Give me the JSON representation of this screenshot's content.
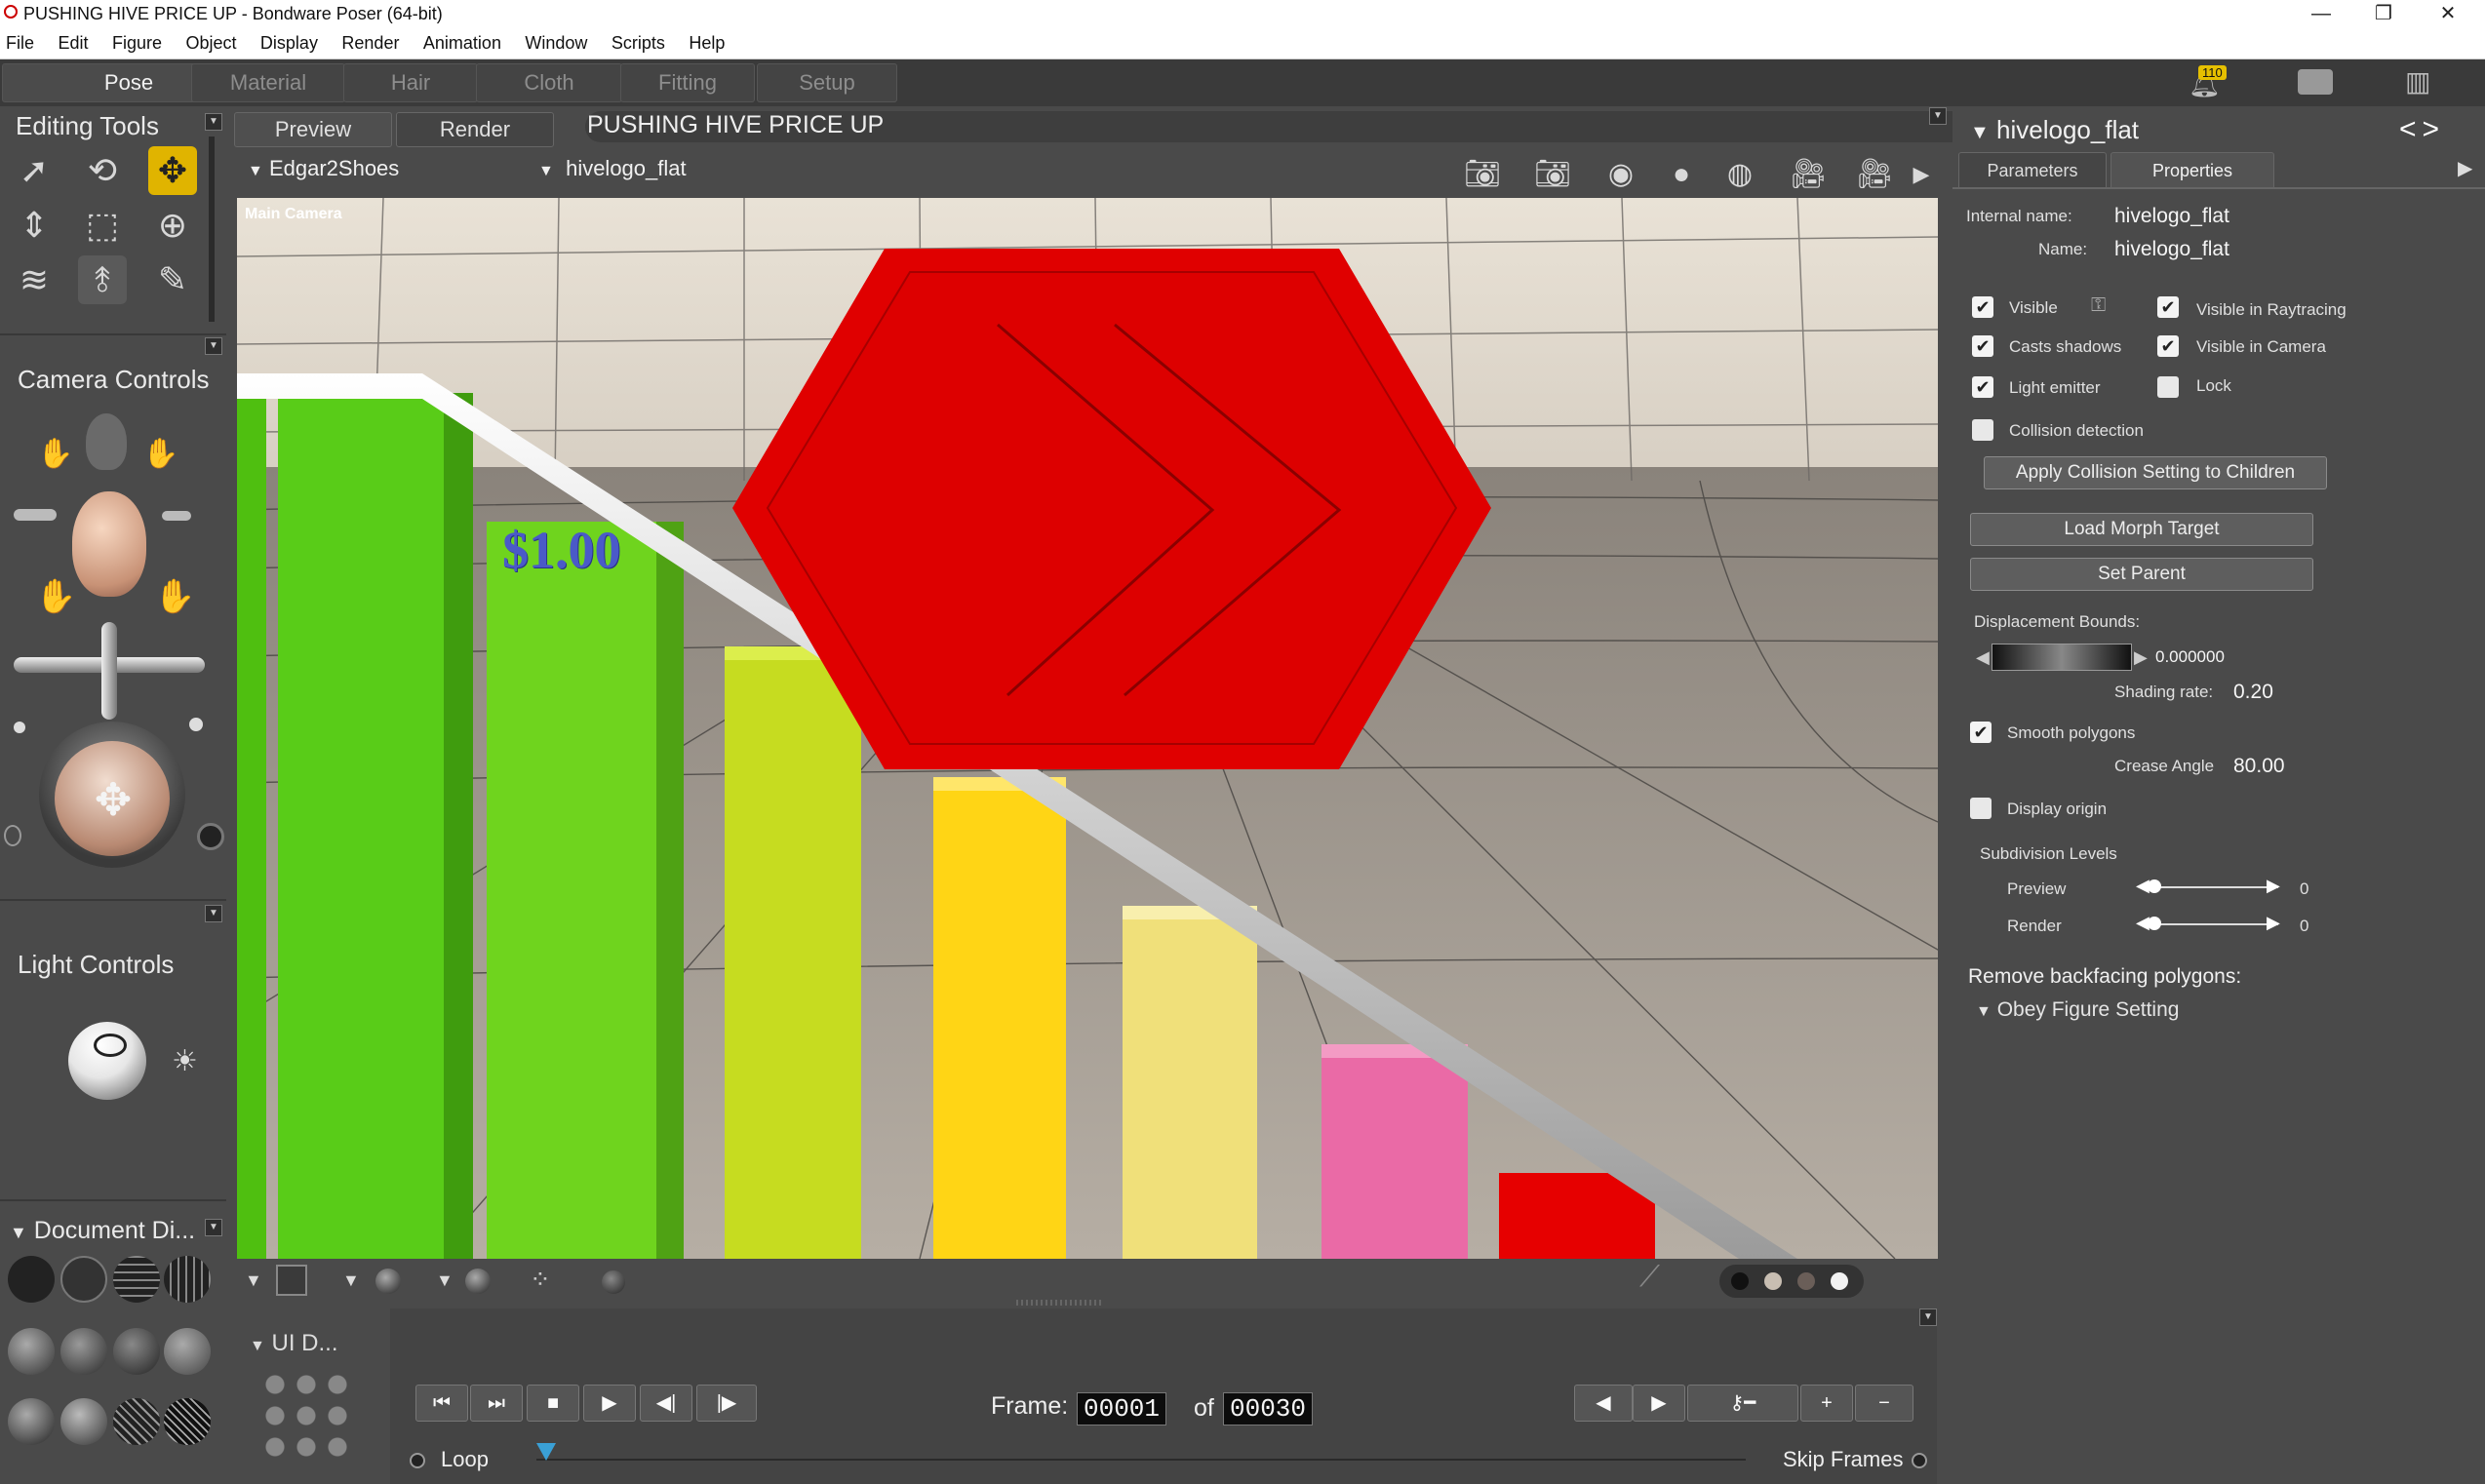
{
  "window": {
    "title": "PUSHING HIVE PRICE UP - Bondware Poser (64-bit)",
    "minimize": "—",
    "maximize": "❐",
    "close": "✕"
  },
  "menu": [
    "File",
    "Edit",
    "Figure",
    "Object",
    "Display",
    "Render",
    "Animation",
    "Window",
    "Scripts",
    "Help"
  ],
  "rooms": [
    "Pose",
    "Material",
    "Hair",
    "Cloth",
    "Fitting",
    "Setup"
  ],
  "top_right": {
    "badge": "110"
  },
  "editing_tools": {
    "title": "Editing Tools"
  },
  "camera_controls": {
    "title": "Camera Controls"
  },
  "light_controls": {
    "title": "Light Controls"
  },
  "document_display": {
    "title": "Document Di..."
  },
  "ui_dots": {
    "title": "UI D..."
  },
  "viewport": {
    "tabs": [
      "Preview",
      "Render"
    ],
    "scene_title": "PUSHING HIVE PRICE UP",
    "figure_select": "Edgar2Shoes",
    "actor_select": "hivelogo_flat",
    "camera_label": "Main Camera",
    "price_label": "$1.00"
  },
  "properties": {
    "header": "hivelogo_flat",
    "tabs": [
      "Parameters",
      "Properties"
    ],
    "internal_name_label": "Internal name:",
    "internal_name": "hivelogo_flat",
    "name_label": "Name:",
    "name": "hivelogo_flat",
    "checks": {
      "visible": "Visible",
      "visible_in_raytracing": "Visible in Raytracing",
      "casts_shadows": "Casts shadows",
      "visible_in_camera": "Visible in Camera",
      "light_emitter": "Light emitter",
      "lock": "Lock",
      "collision_detection": "Collision detection"
    },
    "apply_collision": "Apply Collision Setting to Children",
    "load_morph": "Load Morph Target",
    "set_parent": "Set Parent",
    "displacement_label": "Displacement Bounds:",
    "displacement_value": "0.000000",
    "shading_label": "Shading rate:",
    "shading_value": "0.20",
    "smooth_polygons": "Smooth polygons",
    "crease_label": "Crease Angle",
    "crease_value": "80.00",
    "display_origin": "Display origin",
    "subdivision_label": "Subdivision Levels",
    "preview_label": "Preview",
    "preview_value": "0",
    "render_label": "Render",
    "render_value": "0",
    "backface_label": "Remove backfacing polygons:",
    "backface_value": "Obey Figure Setting"
  },
  "animation": {
    "frame_label": "Frame:",
    "frame_value": "00001",
    "of_label": "of",
    "total_frames": "00030",
    "loop_label": "Loop",
    "skip_frames_label": "Skip Frames"
  }
}
